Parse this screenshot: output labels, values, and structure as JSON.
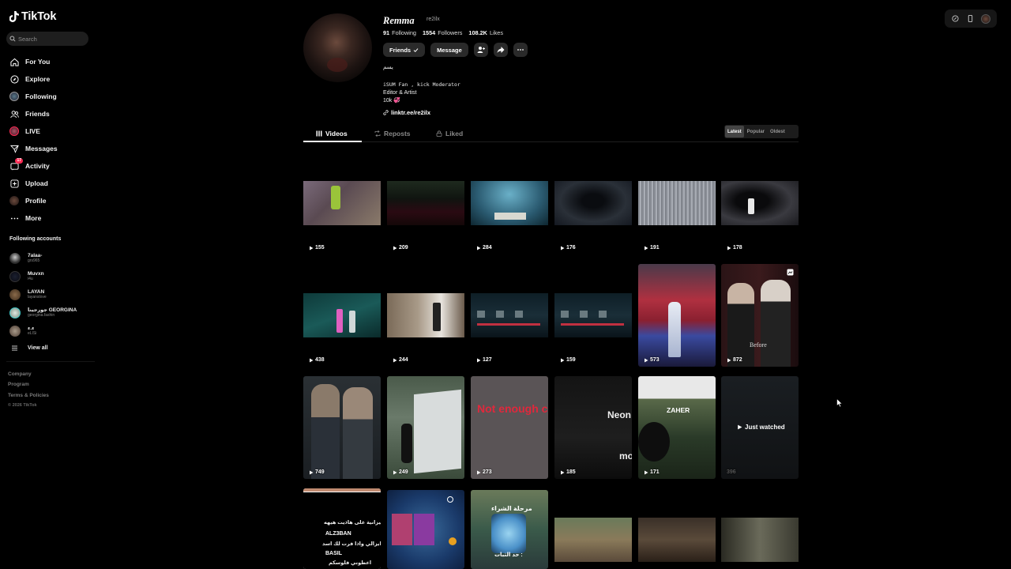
{
  "app": {
    "name": "TikTok"
  },
  "search": {
    "placeholder": "Search"
  },
  "nav": [
    {
      "label": "For You",
      "icon": "home-icon"
    },
    {
      "label": "Explore",
      "icon": "compass-icon"
    },
    {
      "label": "Following",
      "icon": "following-avatar-icon"
    },
    {
      "label": "Friends",
      "icon": "friends-icon"
    },
    {
      "label": "LIVE",
      "icon": "live-icon"
    },
    {
      "label": "Messages",
      "icon": "messages-icon"
    },
    {
      "label": "Activity",
      "icon": "activity-icon",
      "badge": "17"
    },
    {
      "label": "Upload",
      "icon": "upload-icon"
    },
    {
      "label": "Profile",
      "icon": "profile-avatar-icon"
    },
    {
      "label": "More",
      "icon": "more-icon"
    }
  ],
  "following_accounts": {
    "title": "Following accounts",
    "items": [
      {
        "name": "7alaa-",
        "handle": "grs965"
      },
      {
        "name": "Muvxn",
        "handle": "i4u"
      },
      {
        "name": "LAYAN",
        "handle": "layanslove"
      },
      {
        "name": "جورجينا GEORGINA",
        "handle": "georgina.fashin"
      },
      {
        "name": "ء.ء",
        "handle": "eLISi"
      }
    ],
    "view_all": "View all"
  },
  "footer": {
    "company": "Company",
    "program": "Program",
    "terms": "Terms & Policies",
    "copyright": "© 2026 TikTok"
  },
  "profile": {
    "display_name": "Remma",
    "username": "re2ilx",
    "following_count": "91",
    "following_label": "Following",
    "followers_count": "1554",
    "followers_label": "Followers",
    "likes_count": "108.2K",
    "likes_label": "Likes",
    "friends_btn": "Friends",
    "message_btn": "Message",
    "bio_line1": "يسم",
    "bio_line2": "iSUM Fan , kick Moderator",
    "bio_line3": "Editor & Artist",
    "bio_line4": "10k 💞",
    "link": "linktr.ee/re2ilx"
  },
  "tabs": [
    {
      "label": "Videos"
    },
    {
      "label": "Reposts"
    },
    {
      "label": "Liked"
    }
  ],
  "sort": [
    "Latest",
    "Popular",
    "Oldest"
  ],
  "videos_row1": [
    "155",
    "209",
    "284",
    "176",
    "191",
    "178"
  ],
  "videos_row2": [
    "438",
    "244",
    "127",
    "159",
    "573",
    "872"
  ],
  "videos_row3": [
    "749",
    "249",
    "273",
    "185",
    "171",
    "396"
  ],
  "overlays": {
    "not_enough": "Not enough c",
    "neon": "Neon",
    "mo": "mo",
    "zaher": "ZAHER",
    "just_watched": "Just watched",
    "before": "Before",
    "chat_line1": "ت انيزانية على هاذيت هيهه",
    "chat_name1": "ALZ3BAN",
    "chat_line2": "ايزالي واذا فرت لك اسد",
    "chat_name2": "BASIL",
    "chat_line3": "اعطوني فلوسكم",
    "shop_title": "مرحلة الشراء",
    "shop_sub": "حد الثبات :"
  },
  "colors": {
    "accent": "#fe2c55",
    "background": "#000000",
    "button": "#2a2a2a"
  }
}
